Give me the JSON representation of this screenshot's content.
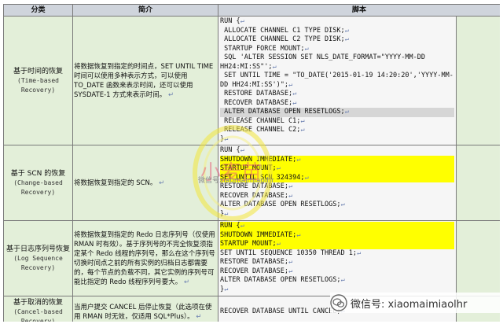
{
  "headers": [
    "分类",
    "简介",
    "脚本"
  ],
  "return_mark": "↵",
  "rows": [
    {
      "category_cn": "基于时间的恢复",
      "category_en": "(Time-based Recovery)",
      "description": "将数据恢复到指定的时间点，SET UNTIL TIME 时间可以使用多种表示方式，可以使用 TO_DATE 函数来表示时间，还可以使用 SYSDATE-1 方式来表示时间。",
      "script": [
        {
          "text": "RUN {",
          "hl": false
        },
        {
          "text": " ALLOCATE CHANNEL C1 TYPE DISK;",
          "hl": false
        },
        {
          "text": " ALLOCATE CHANNEL C2 TYPE DISK;",
          "hl": false
        },
        {
          "text": " STARTUP FORCE MOUNT;",
          "hl": false
        },
        {
          "text": " SQL 'ALTER SESSION SET NLS_DATE_FORMAT=\"YYYY-MM-DD HH24:MI:SS\"';",
          "hl": false
        },
        {
          "text": " SET UNTIL TIME = \"TO_DATE('2015-01-19 14:20:20','YYYY-MM-DD HH24:MI:SS')\";",
          "hl": false
        },
        {
          "text": " RESTORE DATABASE;",
          "hl": false
        },
        {
          "text": " RECOVER DATABASE;",
          "hl": false
        },
        {
          "text": " ALTER DATABASE OPEN RESETLOGS;",
          "hl": "gr"
        },
        {
          "text": " RELEASE CHANNEL C1;",
          "hl": false
        },
        {
          "text": " RELEASE CHANNEL C2;",
          "hl": false
        },
        {
          "text": "}",
          "hl": false
        }
      ]
    },
    {
      "category_cn": "基于 SCN 的恢复",
      "category_en": "(Change-based Recovery)",
      "description": "将数据恢复到指定的 SCN。",
      "script": [
        {
          "text": "RUN {",
          "hl": false
        },
        {
          "text": "SHUTDOWN IMMEDIATE;",
          "hl": true
        },
        {
          "text": "STARTUP MOUNT;",
          "hl": true
        },
        {
          "text": "SET UNTIL SCN 324394;",
          "hl": true
        },
        {
          "text": "RESTORE DATABASE;",
          "hl": false
        },
        {
          "text": "RECOVER DATABASE;",
          "hl": false
        },
        {
          "text": "ALTER DATABASE OPEN RESETLOGS;",
          "hl": false
        },
        {
          "text": "}",
          "hl": false
        }
      ]
    },
    {
      "category_cn": "基于日志序列号恢复",
      "category_en": "(Log Sequence Recovery)",
      "description": "将数据恢复到指定的 Redo 日志序列号（仅使用 RMAN 时有效）。基于序列号的不完全恢复须指定某个 Redo 线程的序列号，那么在这个序列号切换时间点之前的所有实例的归档日志都需要的，每个节点的负载不同，其它实例的序列号可能比指定的 Redo 线程序列号要大。",
      "script": [
        {
          "text": "RUN {",
          "hl": true
        },
        {
          "text": "SHUTDOWN IMMEDIATE;",
          "hl": true
        },
        {
          "text": "STARTUP MOUNT;",
          "hl": true
        },
        {
          "text": "SET UNTIL SEQUENCE 10350 THREAD 1;",
          "hl": false
        },
        {
          "text": "RESTORE DATABASE;",
          "hl": false
        },
        {
          "text": "RECOVER DATABASE;",
          "hl": false
        },
        {
          "text": "ALTER DATABASE OPEN RESETLOGS;",
          "hl": false
        },
        {
          "text": "}",
          "hl": false
        }
      ]
    },
    {
      "category_cn": "基于取消的恢复",
      "category_en": "(Cancel-based Recovery)",
      "description": "当用户提交 CANCEL 后停止恢复（此选项在使用 RMAN 时无效，仅适用 SQL*Plus）。",
      "script": [
        {
          "text": "RECOVER DATABASE UNTIL CANCEL;",
          "hl": false
        }
      ]
    }
  ],
  "watermark": {
    "logo_text": "小麦苗",
    "url_text": "微信号xiaomaimiaolhr"
  },
  "badge": {
    "text": "微信号: xiaomaimiaolhr",
    "icon": "wechat-icon"
  }
}
